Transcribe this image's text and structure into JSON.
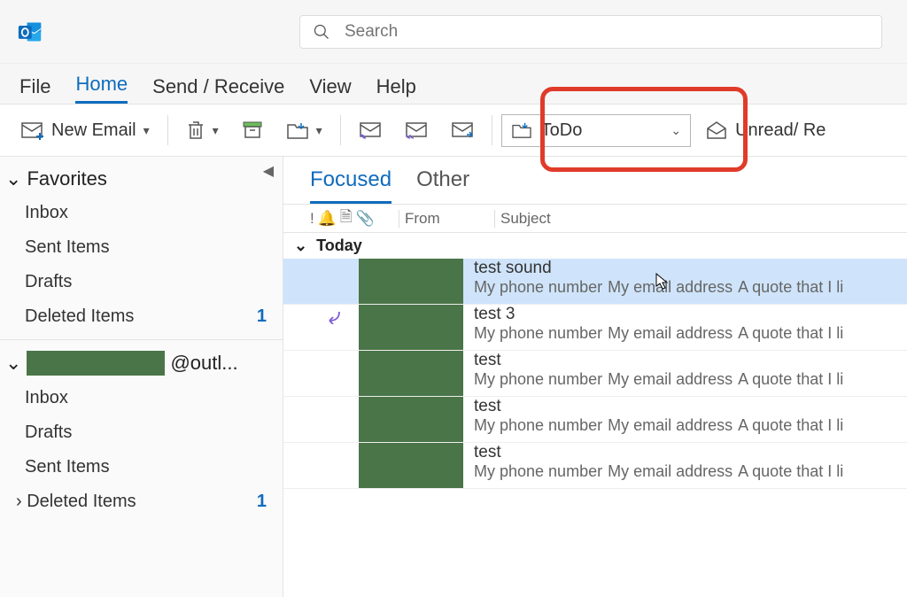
{
  "search": {
    "placeholder": "Search"
  },
  "tabs": {
    "file": "File",
    "home": "Home",
    "sendreceive": "Send / Receive",
    "view": "View",
    "help": "Help"
  },
  "toolbar": {
    "new_email": "New Email",
    "move_to_label": "ToDo",
    "unread_read": "Unread/ Re"
  },
  "sidebar": {
    "favorites": "Favorites",
    "fav_items": [
      {
        "label": "Inbox"
      },
      {
        "label": "Sent Items"
      },
      {
        "label": "Drafts"
      },
      {
        "label": "Deleted Items",
        "count": "1"
      }
    ],
    "account_suffix": "@outl...",
    "account_items": [
      {
        "label": "Inbox"
      },
      {
        "label": "Drafts"
      },
      {
        "label": "Sent Items"
      },
      {
        "label": "Deleted Items",
        "count": "1",
        "expandable": true
      }
    ]
  },
  "list": {
    "focused": "Focused",
    "other": "Other",
    "col_from": "From",
    "col_subject": "Subject",
    "group_today": "Today",
    "preview_parts": [
      "My phone number",
      "My email address",
      "A quote that I li"
    ],
    "messages": [
      {
        "subject": "test sound",
        "selected": true
      },
      {
        "subject": "test 3",
        "reply": true
      },
      {
        "subject": "test"
      },
      {
        "subject": "test"
      },
      {
        "subject": "test"
      }
    ]
  }
}
